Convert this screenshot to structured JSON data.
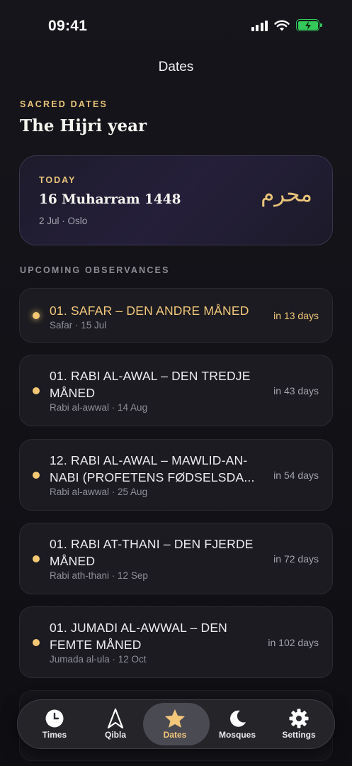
{
  "status_bar": {
    "time": "09:41"
  },
  "nav": {
    "title": "Dates"
  },
  "header": {
    "eyebrow": "SACRED DATES",
    "title": "The Hijri year"
  },
  "today": {
    "label": "TODAY",
    "hijri_date": "16 Muharram 1448",
    "sub": "2 Jul · Oslo",
    "arabic_month": "محرم"
  },
  "upcoming": {
    "title": "UPCOMING OBSERVANCES",
    "items": [
      {
        "name": "01. SAFAR – DEN ANDRE MÅNED",
        "meta": "Safar · 15 Jul",
        "days": "in 13 days"
      },
      {
        "name": "01. RABI AL-AWAL – DEN TREDJE MÅNED",
        "meta": "Rabi al-awwal · 14 Aug",
        "days": "in 43 days"
      },
      {
        "name": "12. RABI AL-AWAL – MAWLID-AN-NABI (PROFETENS FØDSELSDA...",
        "meta": "Rabi al-awwal · 25 Aug",
        "days": "in 54 days"
      },
      {
        "name": "01. RABI AT-THANI – DEN FJERDE MÅNED",
        "meta": "Rabi ath-thani · 12 Sep",
        "days": "in 72 days"
      },
      {
        "name": "01. JUMADI AL-AWWAL – DEN FEMTE MÅNED",
        "meta": "Jumada al-ula · 12 Oct",
        "days": "in 102 days"
      }
    ]
  },
  "tabs": [
    {
      "label": "Times",
      "icon": "clock-icon"
    },
    {
      "label": "Qibla",
      "icon": "compass-arrow-icon"
    },
    {
      "label": "Dates",
      "icon": "star-icon",
      "active": true
    },
    {
      "label": "Mosques",
      "icon": "moon-icon"
    },
    {
      "label": "Settings",
      "icon": "gear-icon"
    }
  ],
  "colors": {
    "accent": "#e9c47a",
    "background": "#131318",
    "card": "#1b1b21",
    "battery": "#34c759"
  }
}
